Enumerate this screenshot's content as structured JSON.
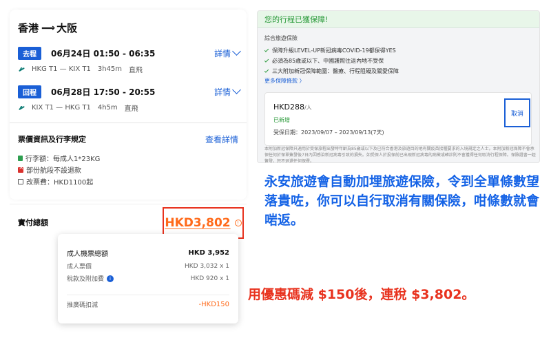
{
  "flight": {
    "origin": "香港",
    "destination": "大阪",
    "route_arrow": "⟹",
    "legs": [
      {
        "badge": "去程",
        "datetime": "06月24日  01:50 - 06:35",
        "detail_label": "詳情",
        "route": "HKG T1 — KIX T1",
        "duration": "3h45m",
        "stops": "直飛",
        "airline_icon": "airline-logo-icon"
      },
      {
        "badge": "回程",
        "datetime": "06月28日  17:50 - 20:55",
        "detail_label": "詳情",
        "route": "KIX T1 — HKG T1",
        "duration": "4h5m",
        "stops": "直飛",
        "airline_icon": "airline-logo-icon"
      }
    ]
  },
  "rules": {
    "title": "票價資訊及行李規定",
    "link": "查看詳情",
    "baggage": "行李額：每成人1*23KG",
    "refund": "部份航段不設退款",
    "change_fee": "改票費：HKD1100起"
  },
  "total": {
    "label": "實付總額",
    "amount": "HKD3,802",
    "info_glyph": "!"
  },
  "breakdown": {
    "adult_total_label": "成人機票總額",
    "adult_total_value": "HKD  3,952",
    "adult_fare_label": "成人票價",
    "adult_fare_value": "HKD  3,032 x 1",
    "tax_label": "稅款及附加費",
    "tax_value": "HKD  920 x 1",
    "discount_label": "推廣碼扣減",
    "discount_value": "-HKD150",
    "info_glyph": "i"
  },
  "insurance": {
    "header": "您的行程已獲保障!",
    "subtitle": "綜合旅遊保險",
    "items": [
      "保障升級LEVEL-UP新冠病毒COVID-19都保得YES",
      "必須為85歲或以下、中國護照往返內地不受保",
      "三大附加新冠保障範圍：醫療、行程阻礙及關愛保障"
    ],
    "more": "更多保障條款  〉",
    "price": "HKD288",
    "price_unit": "/人",
    "added": "已新增",
    "dates": "受保日期：2023/09/07 – 2023/09/13(7天)",
    "cancel": "取消",
    "fine_print": "本附加新冠保障只適用於受保旅程出發時年齡為85歲或以下及已符合香港及旅遊目的地有關疫苗接種要求的入境規定之人士。本附加新冠保障不會承保任何於保單簽發後7日內因感染新冠病毒引致的損失。如受保人於投保前已出現新冠病毒的病徵或確診則不會獲得任何取消行程保障。保險證書一經簽發，恕不退還任何保費。"
  },
  "captions": {
    "blue": "永安旅遊會自動加埋旅遊保險，令到全單條數望落貴咗，你可以自行取消有關保險，咁條數就會啱返。",
    "red": "用優惠碼減 $150後，連稅 $3,802。"
  }
}
